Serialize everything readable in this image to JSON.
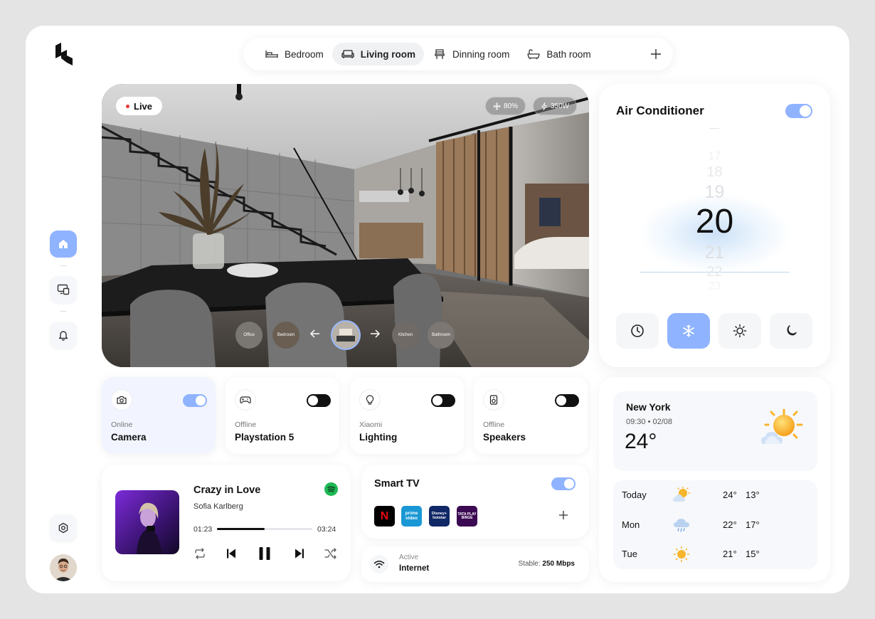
{
  "rooms": [
    {
      "label": "Bedroom",
      "icon": "bed-icon"
    },
    {
      "label": "Living room",
      "icon": "sofa-icon",
      "active": true
    },
    {
      "label": "Dinning room",
      "icon": "dining-chair-icon"
    },
    {
      "label": "Bath room",
      "icon": "bathtub-icon"
    }
  ],
  "camera": {
    "live_label": "Live",
    "fan": "80%",
    "power": "350W",
    "thumbs": [
      "Office",
      "Bedroom",
      "Living room",
      "Kitchen",
      "Bathroom"
    ]
  },
  "ac": {
    "title": "Air Conditioner",
    "on": true,
    "temps": [
      "17",
      "18",
      "19",
      "20",
      "21",
      "22",
      "23"
    ],
    "current": "20",
    "modes": [
      "timer-icon",
      "snowflake-icon",
      "sun-icon",
      "moon-icon"
    ],
    "active_mode": "snowflake-icon"
  },
  "devices": [
    {
      "status": "Online",
      "name": "Camera",
      "on": true,
      "icon": "camera-icon"
    },
    {
      "status": "Offline",
      "name": "Playstation 5",
      "on": false,
      "icon": "gamepad-icon"
    },
    {
      "status": "Xiaomi",
      "name": "Lighting",
      "on": false,
      "icon": "bulb-icon"
    },
    {
      "status": "Offline",
      "name": "Speakers",
      "on": false,
      "icon": "speaker-icon"
    }
  ],
  "music": {
    "title": "Crazy in Love",
    "artist": "Sofia Karlberg",
    "elapsed": "01:23",
    "total": "03:24",
    "progress": 0.5
  },
  "tv": {
    "title": "Smart TV",
    "on": true,
    "apps": [
      {
        "name": "N",
        "color": "#000000",
        "text": "#e50914"
      },
      {
        "name": "prime video",
        "color": "#1a98d5",
        "text": "#ffffff"
      },
      {
        "name": "Disney+ hotstar",
        "color": "#102866",
        "text": "#ffffff"
      },
      {
        "name": "TATA PLAY BINGE",
        "color": "#3b0a52",
        "text": "#ffffff"
      }
    ]
  },
  "internet": {
    "status": "Active",
    "name": "Internet",
    "speed_label": "Stable:",
    "speed_value": "250 Mbps"
  },
  "weather": {
    "city": "New York",
    "time": "09:30 • 02/08",
    "temp": "24°",
    "forecast": [
      {
        "day": "Today",
        "hi": "24°",
        "lo": "13°",
        "icon": "partly-sunny-icon"
      },
      {
        "day": "Mon",
        "hi": "22°",
        "lo": "17°",
        "icon": "rain-cloud-icon"
      },
      {
        "day": "Tue",
        "hi": "21°",
        "lo": "15°",
        "icon": "sun-icon"
      }
    ]
  },
  "colors": {
    "accent": "#8fb3ff",
    "spotify": "#1db954",
    "live": "#e53935"
  }
}
